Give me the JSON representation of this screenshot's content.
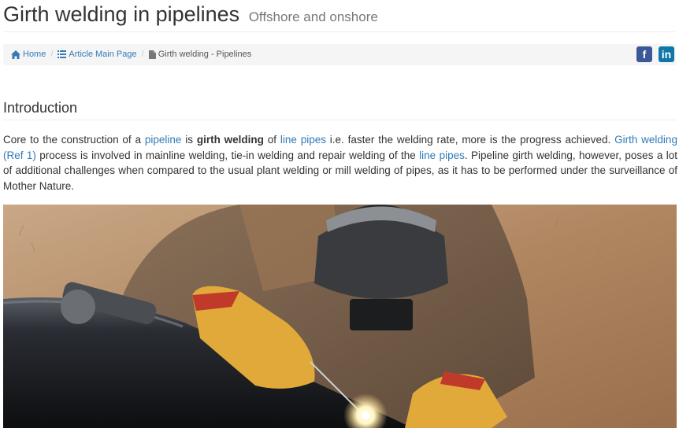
{
  "header": {
    "title": "Girth welding in pipelines",
    "subtitle": "Offshore and onshore"
  },
  "breadcrumb": {
    "items": [
      {
        "label": "Home",
        "icon": "home-icon"
      },
      {
        "label": "Article Main Page",
        "icon": "list-icon"
      },
      {
        "label": "Girth welding - Pipelines",
        "icon": "document-icon"
      }
    ]
  },
  "social": {
    "facebook": "f",
    "linkedin": "in"
  },
  "section": {
    "title": "Introduction"
  },
  "intro": {
    "t1": "Core to the construction of a ",
    "link_pipeline": "pipeline",
    "t2": " is ",
    "bold_girth": "girth welding",
    "t3": " of ",
    "link_line_pipes_1": "line pipes",
    "t4": " i.e. faster the welding rate, more is the progress achieved. ",
    "link_girth_welding": "Girth welding (Ref 1)",
    "t5": " process is involved in mainline welding, tie-in welding and repair welding of the ",
    "link_line_pipes_2": "line pipes",
    "t6": ". Pipeline girth welding, however, poses a lot of additional challenges when compared to the usual plant welding or mill welding of pipes, as it has to be performed under the surveillance of Mother Nature."
  },
  "colors": {
    "link": "#337ab7",
    "facebook": "#3b5998",
    "linkedin": "#0e76a8"
  }
}
